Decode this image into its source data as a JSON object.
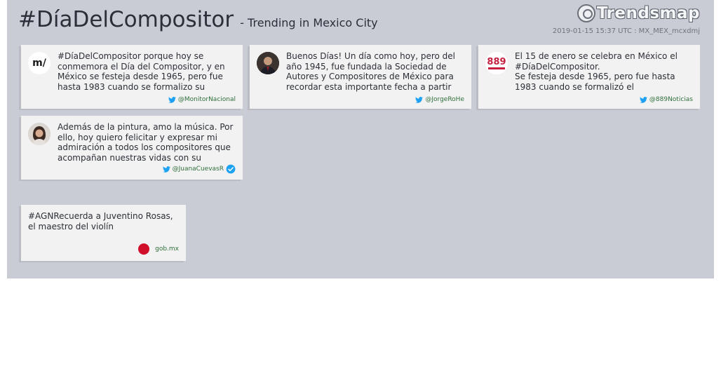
{
  "header": {
    "hashtag": "#DíaDelCompositor",
    "subtitle": "- Trending in Mexico City",
    "logo_text": "Trendsmap",
    "timestamp": "2019-01-15 15:37 UTC : MX_MEX_mcxdmj"
  },
  "tweets": [
    {
      "text": "#DíaDelCompositor porque hoy se conmemora el Día del Compositor, y en México se festeja desde 1965, pero fue hasta 1983 cuando se formalizo su",
      "handle": "@MonitorNacional",
      "avatar_text": "m/"
    },
    {
      "text": "Buenos Días! Un día como hoy, pero del año 1945, fue fundada la Sociedad de Autores y Compositores de México para recordar esta importante fecha a partir de",
      "handle": "@JorgeRoHe"
    },
    {
      "text": "El 15 de enero se celebra en México el #DíaDelCompositor.\nSe festeja desde 1965, pero fue hasta 1983 cuando se formalizó el",
      "handle": "@889Noticias",
      "avatar_text": "889"
    },
    {
      "text": "Además de la pintura, amo la música. Por ello, hoy quiero felicitar y expresar mi admiración a todos los compositores que acompañan nuestras vidas con su",
      "handle": "@JuanaCuevasR"
    }
  ],
  "link": {
    "text": "#AGNRecuerda a Juventino Rosas, el maestro del violín",
    "source": "gob.mx"
  },
  "colors": {
    "panel": "#c9ccd4",
    "twitter": "#1da1f2",
    "verified": "#1da1f2",
    "gob_dot": "#d0102a"
  }
}
